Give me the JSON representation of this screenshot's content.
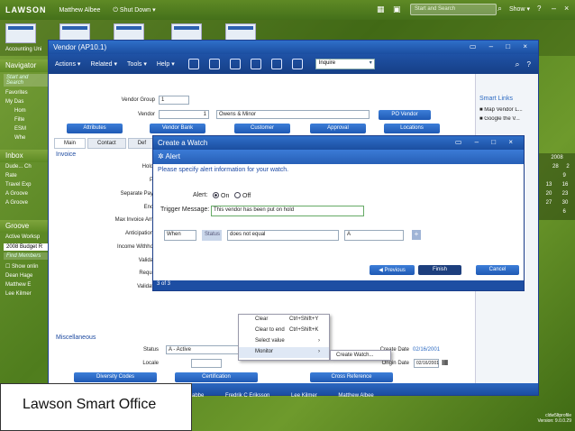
{
  "topbar": {
    "logo": "LAWSON",
    "user": "Matthew Albee",
    "shutdown": "Shut Down",
    "search_placeholder": "Start and Search",
    "show": "Show"
  },
  "thumbs": {
    "label": "Accounting Uni"
  },
  "navigator": {
    "title": "Navigator",
    "search_placeholder": "Start and Search",
    "favorites": "Favorites",
    "items": [
      "My Das",
      "Hom",
      "Filte",
      "ESM",
      "Whe"
    ]
  },
  "inbox": {
    "title": "Inbox",
    "items": [
      "Dude... Ch",
      "Rate",
      "Travel Exp",
      "A Groove",
      "A Groove"
    ]
  },
  "groove": {
    "title": "Groove",
    "active_workspace": "Active Worksp",
    "workspace_value": "2008 Budget R",
    "find_members": "Find Members",
    "show_online": "Show onlin",
    "members": [
      "Dean Hage",
      "Matthew E",
      "Lee Kilmer"
    ]
  },
  "vendor": {
    "title": "Vendor (AP10.1)",
    "menus": [
      "Actions",
      "Related",
      "Tools",
      "Help"
    ],
    "inquire": "Inquire",
    "vendor_group_label": "Vendor Group",
    "vendor_group_value": "1",
    "vendor_label": "Vendor",
    "vendor_value": "1",
    "vendor_name": "Owens & Minor",
    "po_vendor": "PO Vendor",
    "buttons": [
      "Attributes",
      "Vendor Bank",
      "Customer",
      "Approval",
      "Locations"
    ],
    "tabs": [
      "Main",
      "Contact",
      "Def"
    ],
    "invoice": "Invoice",
    "invoice_labels": [
      "Hold",
      "P",
      "Separate Pay",
      "Enc",
      "Max Invoice Am",
      "Anticipation",
      "Income Withho",
      "Valida",
      "Requi",
      "Validat"
    ],
    "misc": "Miscellaneous",
    "status_label": "Status",
    "status_value": "A - Active",
    "locale_label": "Locale",
    "create_date_label": "Create Date",
    "create_date_value": "02/16/2001",
    "origin_date_label": "Origin Date",
    "origin_date_value": "02/16/2001",
    "bottom_buttons": [
      "Diversity Codes",
      "Certification",
      "Cross Reference"
    ]
  },
  "smart_links": {
    "title": "Smart Links",
    "items": [
      "Map Vendor L...",
      "Google the V..."
    ]
  },
  "calendar": {
    "year": "2008",
    "rows": [
      [
        "",
        "28",
        "2"
      ],
      [
        "",
        "9"
      ],
      [
        "13",
        "16"
      ],
      [
        "20",
        "23"
      ],
      [
        "27",
        "30"
      ],
      [
        "",
        "6"
      ]
    ]
  },
  "watch": {
    "title": "Create a Watch",
    "alert": "Alert",
    "instruction": "Please specify alert information for your watch.",
    "alert_label": "Alert:",
    "on": "On",
    "off": "Off",
    "trigger_label": "Trigger Message:",
    "trigger_value": "This vendor has been put on hold",
    "when": "When",
    "status": "Status",
    "condition": "does not equal",
    "value": "A",
    "previous": "Previous",
    "finish": "Finish",
    "cancel": "Cancel",
    "footer": "3 of 3"
  },
  "context_menu": [
    {
      "label": "Clear",
      "shortcut": "Ctrl+Shift+Y"
    },
    {
      "label": "Clear to end",
      "shortcut": "Ctrl+Shift+K"
    },
    {
      "label": "Select value",
      "shortcut": "›"
    },
    {
      "label": "Monitor",
      "shortcut": "›"
    }
  ],
  "submenu": {
    "label": "Create Watch..."
  },
  "taskbar": [
    "abbe",
    "Fredrik C Eriksson",
    "Lee Kilmer",
    "Matthew Albee"
  ],
  "version": {
    "profile": "cldw5ltprofile",
    "version": "Version: 9.0.0.29"
  },
  "caption": "Lawson Smart Office",
  "colors": {
    "accent": "#1f52a6",
    "desktop": "#5d8a23"
  }
}
